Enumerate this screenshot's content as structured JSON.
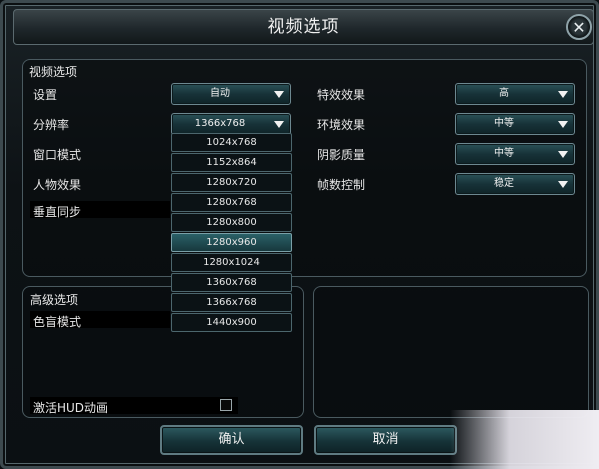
{
  "window": {
    "title": "视频选项",
    "close_symbol": "✕"
  },
  "video": {
    "section_title": "视频选项",
    "left_rows": [
      {
        "label": "设置",
        "value": "自动"
      },
      {
        "label": "分辨率",
        "value": "1366x768"
      },
      {
        "label": "窗口模式"
      },
      {
        "label": "人物效果"
      },
      {
        "label": "垂直同步"
      }
    ],
    "right_rows": [
      {
        "label": "特效效果",
        "value": "高"
      },
      {
        "label": "环境效果",
        "value": "中等"
      },
      {
        "label": "阴影质量",
        "value": "中等"
      },
      {
        "label": "帧数控制",
        "value": "稳定"
      }
    ]
  },
  "resolution_dropdown": {
    "options": [
      "1024x768",
      "1152x864",
      "1280x720",
      "1280x768",
      "1280x800",
      "1280x960",
      "1280x1024",
      "1360x768",
      "1366x768",
      "1440x900"
    ],
    "highlighted": "1280x960"
  },
  "advanced": {
    "section_title": "高级选项",
    "colorblind_label": "色盲模式",
    "hud_label": "激活HUD动画",
    "hud_checked": false
  },
  "buttons": {
    "confirm": "确认",
    "cancel": "取消"
  },
  "colors": {
    "accent": "#2b5258",
    "border": "#6d8890",
    "background": "#0d1215"
  }
}
